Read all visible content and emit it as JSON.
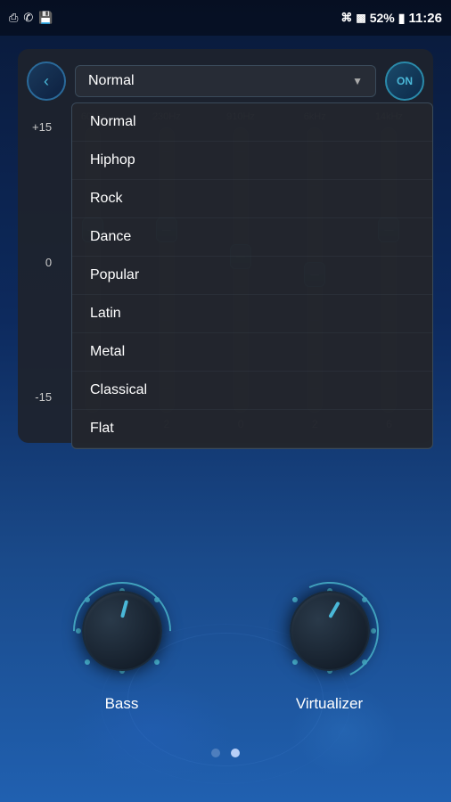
{
  "statusBar": {
    "time": "11:26",
    "battery": "52%",
    "icons": [
      "usb-icon",
      "phone-icon",
      "sd-icon",
      "wifi-icon",
      "signal-icon",
      "battery-icon"
    ]
  },
  "header": {
    "back_label": "‹",
    "on_label": "ON",
    "preset": {
      "selected": "Normal",
      "options": [
        "Normal",
        "Hiphop",
        "Rock",
        "Dance",
        "Popular",
        "Latin",
        "Metal",
        "Classical",
        "Flat"
      ]
    }
  },
  "equalizer": {
    "levels": [
      "+15",
      "0",
      "-15"
    ],
    "frequencies": [
      "60Hz",
      "230Hz",
      "910Hz",
      "6kHz",
      "14kHz"
    ],
    "values": [
      "6",
      "2",
      "0",
      "2",
      "6"
    ],
    "thumbPositions": [
      0.35,
      0.35,
      0.45,
      0.5,
      0.35
    ]
  },
  "knobs": [
    {
      "label": "Bass"
    },
    {
      "label": "Virtualizer"
    }
  ],
  "pagination": {
    "total": 2,
    "active": 1
  }
}
